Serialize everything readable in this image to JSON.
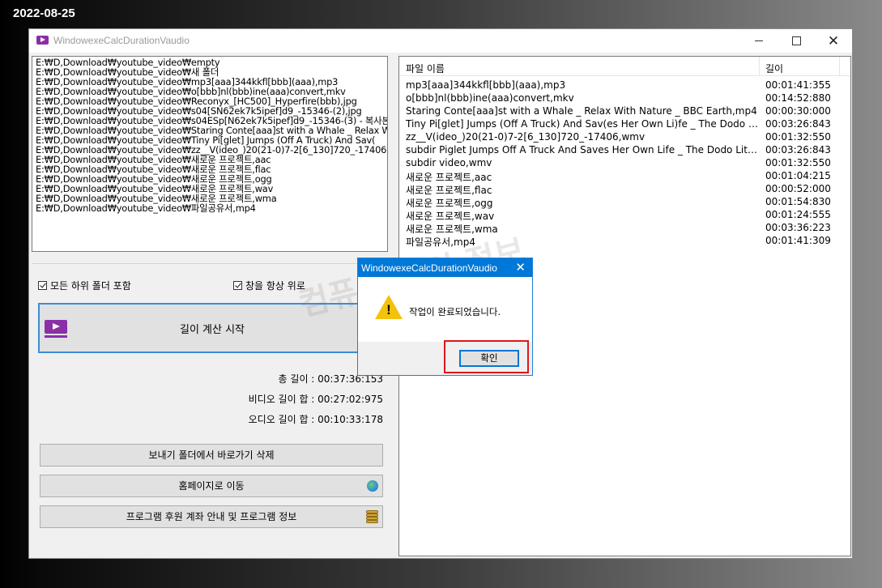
{
  "date_stamp": "2022-08-25",
  "window": {
    "title": "WindowexeCalcDurationVaudio",
    "close_glyph": "✕"
  },
  "paths": [
    "E:₩D,Download₩youtube_video₩empty",
    "E:₩D,Download₩youtube_video₩새 폴더",
    "E:₩D,Download₩youtube_video₩mp3[aaa]344kkfl[bbb](aaa),mp3",
    "E:₩D,Download₩youtube_video₩o[bbb]nl(bbb)ine(aaa)convert,mkv",
    "E:₩D,Download₩youtube_video₩Reconyx_[HC500]_Hyperfire(bbb),jpg",
    "E:₩D,Download₩youtube_video₩s04[SN62ek7k5ipef]d9_-15346-(2),jpg",
    "E:₩D,Download₩youtube_video₩s04ESp[N62ek7k5ipef]d9_-15346-(3) - 복사본",
    "E:₩D,Download₩youtube_video₩Staring Conte[aaa]st with a Whale _ Relax W",
    "E:₩D,Download₩youtube_video₩Tiny Pi[glet] Jumps (Off A Truck) And Sav(",
    "E:₩D,Download₩youtube_video₩zz__V(ideo_)20(21-0)7-2[6_130]720_-17406,w",
    "E:₩D,Download₩youtube_video₩새로운 프로젝트,aac",
    "E:₩D,Download₩youtube_video₩새로운 프로젝트,flac",
    "E:₩D,Download₩youtube_video₩새로운 프로젝트,ogg",
    "E:₩D,Download₩youtube_video₩새로운 프로젝트,wav",
    "E:₩D,Download₩youtube_video₩새로운 프로젝트,wma",
    "E:₩D,Download₩youtube_video₩파일공유서,mp4"
  ],
  "options": {
    "include_subfolders_label": "모든 하위 폴더 포함",
    "always_on_top_label": "창을 항상 위로"
  },
  "start_button_label": "길이 계산 시작",
  "stats": {
    "total": "총 길이 : 00:37:36:153",
    "video": "비디오 길이 합 : 00:27:02:975",
    "audio": "오디오 길이 합 : 00:10:33:178"
  },
  "buttons": {
    "delete_shortcut": "보내기 폴더에서 바로가기 삭제",
    "homepage": "홈페이지로 이동",
    "donate_info": "프로그램 후원 계좌 안내 및 프로그램 정보"
  },
  "table": {
    "col_name": "파일 이름",
    "col_length": "길이",
    "rows": [
      {
        "name": "mp3[aaa]344kkfl[bbb](aaa),mp3",
        "length": "00:01:41:355"
      },
      {
        "name": "o[bbb]nl(bbb)ine(aaa)convert,mkv",
        "length": "00:14:52:880"
      },
      {
        "name": "Staring Conte[aaa]st with a Whale _ Relax With Nature _ BBC Earth,mp4",
        "length": "00:00:30:000"
      },
      {
        "name": "Tiny Pi[glet] Jumps (Off A Truck) And Sav(es Her Own Li)fe _ The Dodo L...",
        "length": "00:03:26:843"
      },
      {
        "name": "zz__V(ideo_)20(21-0)7-2[6_130]720_-17406,wmv",
        "length": "00:01:32:550"
      },
      {
        "name": "subdir Piglet Jumps Off A Truck And Saves Her Own Life _ The Dodo Little ...",
        "length": "00:03:26:843"
      },
      {
        "name": "subdir video,wmv",
        "length": "00:01:32:550"
      },
      {
        "name": "새로운 프로젝트,aac",
        "length": "00:01:04:215"
      },
      {
        "name": "새로운 프로젝트,flac",
        "length": "00:00:52:000"
      },
      {
        "name": "새로운 프로젝트,ogg",
        "length": "00:01:54:830"
      },
      {
        "name": "새로운 프로젝트,wav",
        "length": "00:01:24:555"
      },
      {
        "name": "새로운 프로젝트,wma",
        "length": "00:03:36:223"
      },
      {
        "name": "파일공유서,mp4",
        "length": "00:01:41:309"
      }
    ]
  },
  "dialog": {
    "title": "WindowexeCalcDurationVaudio",
    "message": "작업이 완료되었습니다.",
    "ok_label": "확인",
    "warning_mark": "!"
  },
  "watermark": "컴퓨터 관련 정보",
  "colors": {
    "accent_blue": "#0078d7",
    "highlight_red": "#e0151b",
    "warning_yellow": "#f4c20d",
    "app_icon_purple": "#8b2ea8"
  },
  "icons": [
    "app-icon",
    "video-icon",
    "globe-icon",
    "coins-icon",
    "warning-icon",
    "close-icon",
    "minimize-icon",
    "maximize-icon"
  ]
}
